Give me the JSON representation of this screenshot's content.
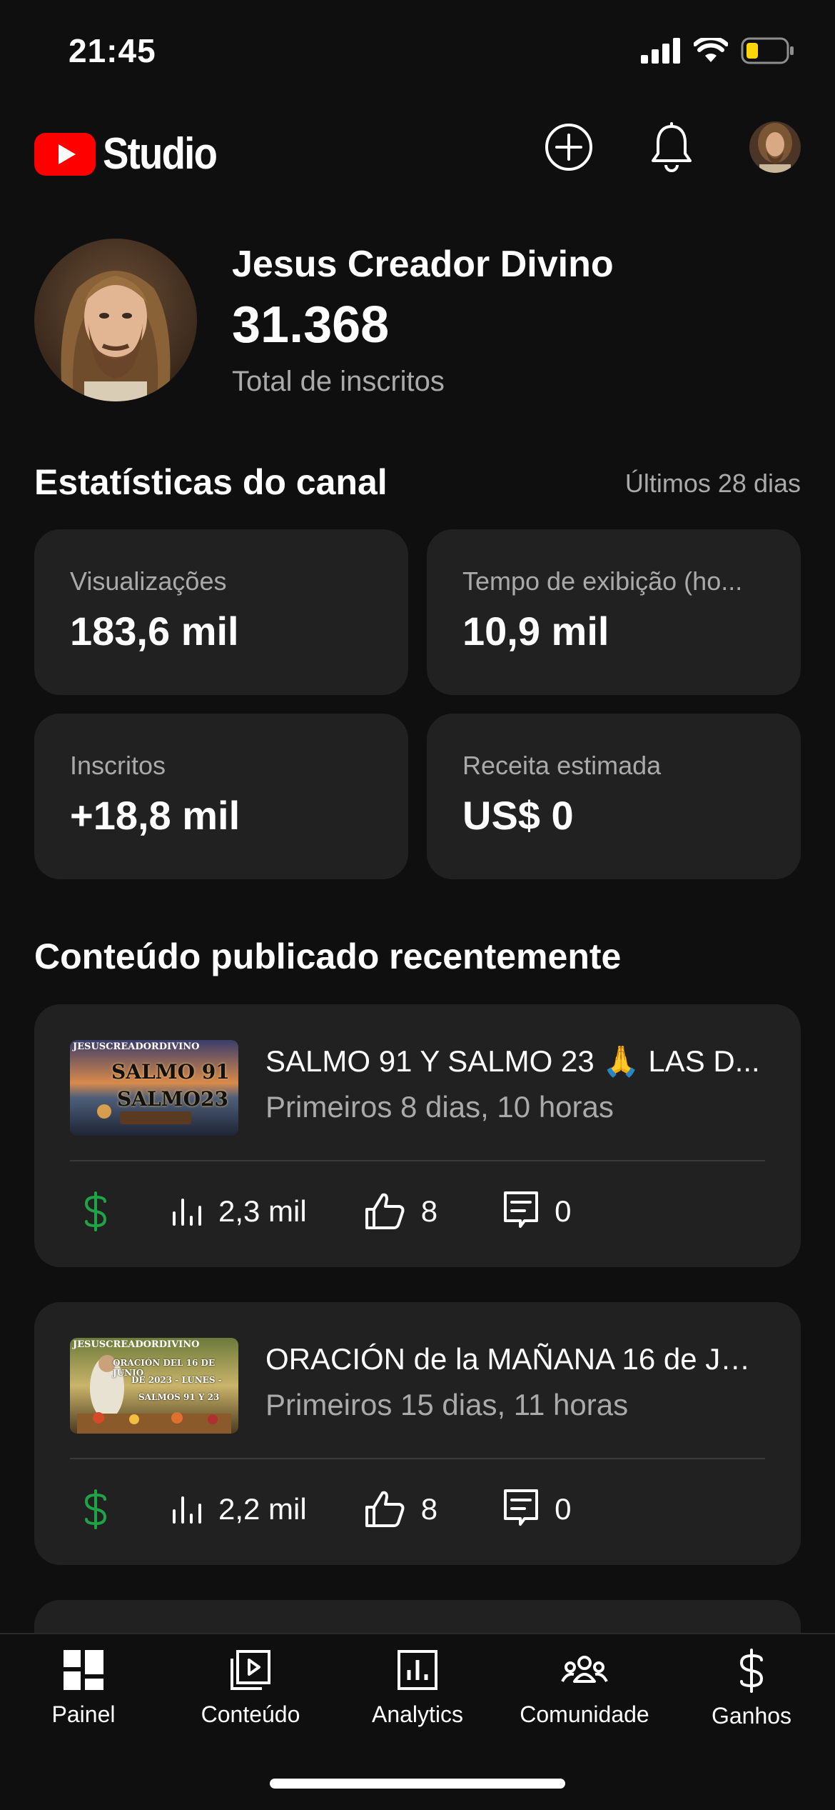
{
  "status_bar": {
    "time": "21:45"
  },
  "header": {
    "app_name": "Studio"
  },
  "channel": {
    "name": "Jesus Creador Divino",
    "subscribers": "31.368",
    "subscribers_label": "Total de inscritos"
  },
  "stats": {
    "title": "Estatísticas do canal",
    "period": "Últimos 28 dias",
    "cards": [
      {
        "label": "Visualizações",
        "value": "183,6 mil"
      },
      {
        "label": "Tempo de exibição (ho...",
        "value": "10,9 mil"
      },
      {
        "label": "Inscritos",
        "value": "+18,8 mil"
      },
      {
        "label": "Receita estimada",
        "value": "US$ 0"
      }
    ]
  },
  "recent": {
    "title": "Conteúdo publicado recentemente",
    "videos": [
      {
        "title": "SALMO 91 Y SALMO 23 🙏 LAS D...",
        "subtitle": "Primeiros 8 dias, 10 horas",
        "views": "2,3 mil",
        "likes": "8",
        "comments": "0",
        "thumb_text": [
          "JESUSCREADORDIVINO",
          "SALMO 91",
          "SALMO23"
        ]
      },
      {
        "title": "ORACIÓN de la MAÑANA 16 de JU...",
        "subtitle": "Primeiros 15 dias, 11 horas",
        "views": "2,2 mil",
        "likes": "8",
        "comments": "0",
        "thumb_text": [
          "JESUSCREADORDIVINO",
          "ORACIÓN DEL 16 DE JUNIO",
          "DE 2023 - LUNES -",
          "SALMOS 91 Y 23"
        ]
      }
    ]
  },
  "nav": {
    "items": [
      {
        "label": "Painel",
        "icon": "dashboard-icon"
      },
      {
        "label": "Conteúdo",
        "icon": "content-icon"
      },
      {
        "label": "Analytics",
        "icon": "analytics-icon"
      },
      {
        "label": "Comunidade",
        "icon": "community-icon"
      },
      {
        "label": "Ganhos",
        "icon": "earn-icon"
      }
    ]
  },
  "colors": {
    "accent_red": "#ff0000",
    "money_green": "#1ea446",
    "battery_yellow": "#ffd60a",
    "card_bg": "#212121",
    "page_bg": "#0f0f0f"
  }
}
